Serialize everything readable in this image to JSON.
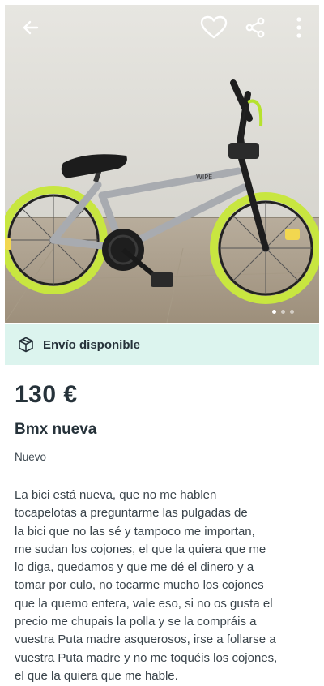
{
  "listing": {
    "price": "130 €",
    "title": "Bmx nueva",
    "condition": "Nuevo",
    "description_lines": [
      "La bici está nueva, que no me hablen",
      "tocapelotas a preguntarme las pulgadas de",
      "la bici que no las sé y tampoco me importan,",
      "me sudan los cojones, el que la quiera que me",
      "lo diga, quedamos y que me dé el dinero y a",
      "tomar por culo, no tocarme mucho los cojones",
      "que la quemo entera, vale eso, si no os gusta el",
      "precio me chupais la polla y se la compráis a",
      "vuestra Puta madre asquerosos, irse a follarse a",
      "vuestra Puta madre y no me toquéis los cojones,",
      "el que la quiera que me hable."
    ]
  },
  "shipping": {
    "label": "Envío disponible",
    "icon": "package-icon"
  },
  "topbar": {
    "icons": [
      "arrow-left-icon",
      "heart-icon",
      "share-icon",
      "more-vertical-icon"
    ]
  },
  "gallery": {
    "image_count": 3,
    "active_index": 0
  },
  "colors": {
    "shipping_bg": "#dcf4ee",
    "text_primary": "#26323a",
    "rim_yellow": "#c8e640"
  }
}
